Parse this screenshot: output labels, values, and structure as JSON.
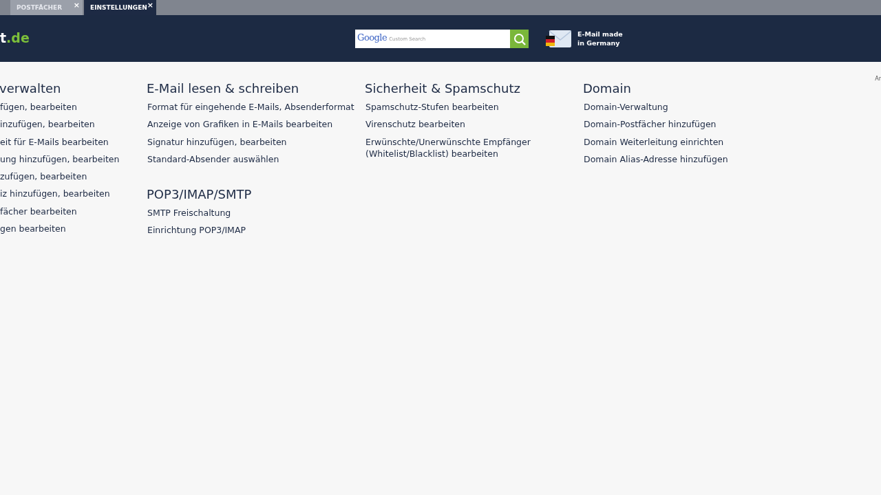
{
  "tabs": [
    {
      "label": "POSTFÄCHER",
      "close": "×",
      "selected": false
    },
    {
      "label": "EINSTELLUNGEN",
      "close": "×",
      "selected": true
    }
  ],
  "header": {
    "logo": {
      "text": "t",
      "suffix": ".de"
    },
    "search": {
      "brand": "Google",
      "placeholder": "Custom Search"
    },
    "badge": "E-Mail made\nin Germany"
  },
  "sections": [
    {
      "title": "verwalten",
      "links": [
        "fügen, bearbeiten",
        "inzufügen, bearbeiten",
        "eit für E-Mails bearbeiten",
        "ung hinzufügen, bearbeiten",
        "zufügen, bearbeiten",
        "iz hinzufügen, bearbeiten",
        "fächer bearbeiten",
        "gen bearbeiten"
      ]
    },
    {
      "title": "E-Mail lesen & schreiben",
      "links": [
        "Format für eingehende E-Mails, Absenderformat",
        "Anzeige von Grafiken in E-Mails bearbeiten",
        "Signatur hinzufügen, bearbeiten",
        "Standard-Absender auswählen"
      ]
    },
    {
      "title": "POP3/IMAP/SMTP",
      "links": [
        "SMTP Freischaltung",
        "Einrichtung POP3/IMAP"
      ]
    },
    {
      "title": "Sicherheit & Spamschutz",
      "links": [
        "Spamschutz-Stufen bearbeiten",
        "Virenschutz bearbeiten",
        "Erwünschte/Unerwünschte Empfänger\n(Whitelist/Blacklist) bearbeiten"
      ]
    },
    {
      "title": "Domain",
      "links": [
        "Domain-Verwaltung",
        "Domain-Postfächer hinzufügen",
        "Domain Weiterleitung einrichten",
        "Domain Alias-Adresse hinzufügen"
      ]
    }
  ],
  "side_note": "Ar"
}
